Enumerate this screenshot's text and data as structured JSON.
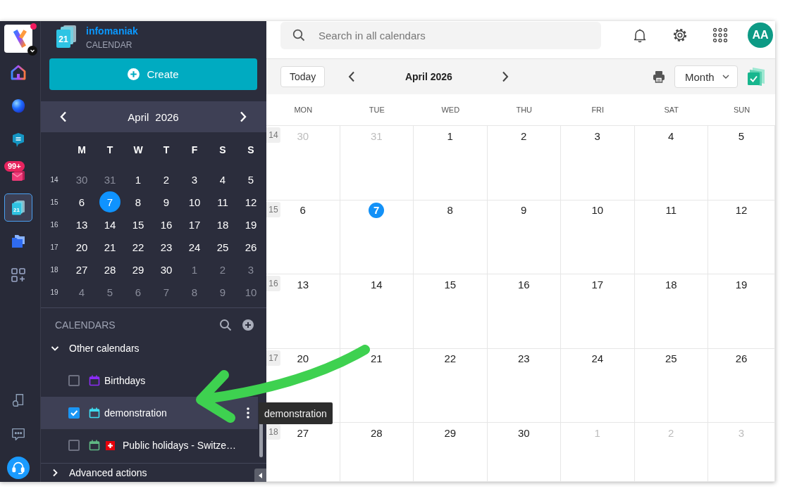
{
  "rail": {
    "logo": {
      "notification": true
    },
    "items": [
      {
        "selected": false
      },
      {
        "selected": false
      },
      {
        "selected": false
      },
      {
        "selected": false,
        "badge": "99+"
      },
      {
        "selected": true,
        "icon_text": "21"
      },
      {
        "selected": false
      },
      {
        "selected": false
      }
    ]
  },
  "sidebar": {
    "brand": {
      "name": "infomaniak",
      "product": "CALENDAR",
      "icon_text": "21"
    },
    "create_button": {
      "label": "Create"
    },
    "mini_calendar": {
      "month": "April",
      "year": "2026",
      "weekdays": [
        "M",
        "T",
        "W",
        "T",
        "F",
        "S",
        "S"
      ],
      "weeks": [
        {
          "number": "14",
          "days": [
            {
              "label": "30",
              "outside_month": true,
              "selected": false
            },
            {
              "label": "31",
              "outside_month": true,
              "selected": false
            },
            {
              "label": "1",
              "outside_month": false,
              "selected": false
            },
            {
              "label": "2",
              "outside_month": false,
              "selected": false
            },
            {
              "label": "3",
              "outside_month": false,
              "selected": false
            },
            {
              "label": "4",
              "outside_month": false,
              "selected": false
            },
            {
              "label": "5",
              "outside_month": false,
              "selected": false
            }
          ]
        },
        {
          "number": "15",
          "days": [
            {
              "label": "6",
              "outside_month": false,
              "selected": false
            },
            {
              "label": "7",
              "outside_month": false,
              "selected": true
            },
            {
              "label": "8",
              "outside_month": false,
              "selected": false
            },
            {
              "label": "9",
              "outside_month": false,
              "selected": false
            },
            {
              "label": "10",
              "outside_month": false,
              "selected": false
            },
            {
              "label": "11",
              "outside_month": false,
              "selected": false
            },
            {
              "label": "12",
              "outside_month": false,
              "selected": false
            }
          ]
        },
        {
          "number": "16",
          "days": [
            {
              "label": "13",
              "outside_month": false,
              "selected": false
            },
            {
              "label": "14",
              "outside_month": false,
              "selected": false
            },
            {
              "label": "15",
              "outside_month": false,
              "selected": false
            },
            {
              "label": "16",
              "outside_month": false,
              "selected": false
            },
            {
              "label": "17",
              "outside_month": false,
              "selected": false
            },
            {
              "label": "18",
              "outside_month": false,
              "selected": false
            },
            {
              "label": "19",
              "outside_month": false,
              "selected": false
            }
          ]
        },
        {
          "number": "17",
          "days": [
            {
              "label": "20",
              "outside_month": false,
              "selected": false
            },
            {
              "label": "21",
              "outside_month": false,
              "selected": false
            },
            {
              "label": "22",
              "outside_month": false,
              "selected": false
            },
            {
              "label": "23",
              "outside_month": false,
              "selected": false
            },
            {
              "label": "24",
              "outside_month": false,
              "selected": false
            },
            {
              "label": "25",
              "outside_month": false,
              "selected": false
            },
            {
              "label": "26",
              "outside_month": false,
              "selected": false
            }
          ]
        },
        {
          "number": "18",
          "days": [
            {
              "label": "27",
              "outside_month": false,
              "selected": false
            },
            {
              "label": "28",
              "outside_month": false,
              "selected": false
            },
            {
              "label": "29",
              "outside_month": false,
              "selected": false
            },
            {
              "label": "30",
              "outside_month": false,
              "selected": false
            },
            {
              "label": "1",
              "outside_month": true,
              "selected": false
            },
            {
              "label": "2",
              "outside_month": true,
              "selected": false
            },
            {
              "label": "3",
              "outside_month": true,
              "selected": false
            }
          ]
        },
        {
          "number": "19",
          "days": [
            {
              "label": "4",
              "outside_month": true,
              "selected": false
            },
            {
              "label": "5",
              "outside_month": true,
              "selected": false
            },
            {
              "label": "6",
              "outside_month": true,
              "selected": false
            },
            {
              "label": "7",
              "outside_month": true,
              "selected": false
            },
            {
              "label": "8",
              "outside_month": true,
              "selected": false
            },
            {
              "label": "9",
              "outside_month": true,
              "selected": false
            },
            {
              "label": "10",
              "outside_month": true,
              "selected": false
            }
          ]
        }
      ]
    },
    "calendars": {
      "title": "CALENDARS",
      "groups": [
        {
          "label": "Other calendars",
          "expanded": true,
          "items": [
            {
              "name": "Birthdays",
              "checked": false,
              "selected": false,
              "color": "#8b2cf5",
              "flag": false
            },
            {
              "name": "demonstration",
              "checked": true,
              "selected": true,
              "color": "#3fdcf0",
              "flag": false
            },
            {
              "name": "Public holidays - Switze…",
              "checked": false,
              "selected": false,
              "color": "#5fb884",
              "flag": true
            }
          ]
        }
      ]
    },
    "advanced_actions": {
      "label": "Advanced actions",
      "expanded": false
    }
  },
  "topbar": {
    "search": {
      "placeholder": "Search in all calendars"
    },
    "avatar": {
      "initials": "AA"
    }
  },
  "toolbar": {
    "today": "Today",
    "title": "April 2026",
    "view": {
      "value": "Month"
    }
  },
  "month_grid": {
    "columns": [
      "MON",
      "TUE",
      "WED",
      "THU",
      "FRI",
      "SAT",
      "SUN"
    ],
    "weeks": [
      {
        "number": "14",
        "days": [
          {
            "label": "30",
            "outside_month": true,
            "selected": false
          },
          {
            "label": "31",
            "outside_month": true,
            "selected": false
          },
          {
            "label": "1",
            "outside_month": false,
            "selected": false
          },
          {
            "label": "2",
            "outside_month": false,
            "selected": false
          },
          {
            "label": "3",
            "outside_month": false,
            "selected": false
          },
          {
            "label": "4",
            "outside_month": false,
            "selected": false
          },
          {
            "label": "5",
            "outside_month": false,
            "selected": false
          }
        ]
      },
      {
        "number": "15",
        "days": [
          {
            "label": "6",
            "outside_month": false,
            "selected": false
          },
          {
            "label": "7",
            "outside_month": false,
            "selected": true
          },
          {
            "label": "8",
            "outside_month": false,
            "selected": false
          },
          {
            "label": "9",
            "outside_month": false,
            "selected": false
          },
          {
            "label": "10",
            "outside_month": false,
            "selected": false
          },
          {
            "label": "11",
            "outside_month": false,
            "selected": false
          },
          {
            "label": "12",
            "outside_month": false,
            "selected": false
          }
        ]
      },
      {
        "number": "16",
        "days": [
          {
            "label": "13",
            "outside_month": false,
            "selected": false
          },
          {
            "label": "14",
            "outside_month": false,
            "selected": false
          },
          {
            "label": "15",
            "outside_month": false,
            "selected": false
          },
          {
            "label": "16",
            "outside_month": false,
            "selected": false
          },
          {
            "label": "17",
            "outside_month": false,
            "selected": false
          },
          {
            "label": "18",
            "outside_month": false,
            "selected": false
          },
          {
            "label": "19",
            "outside_month": false,
            "selected": false
          }
        ]
      },
      {
        "number": "17",
        "days": [
          {
            "label": "20",
            "outside_month": false,
            "selected": false
          },
          {
            "label": "21",
            "outside_month": false,
            "selected": false
          },
          {
            "label": "22",
            "outside_month": false,
            "selected": false
          },
          {
            "label": "23",
            "outside_month": false,
            "selected": false
          },
          {
            "label": "24",
            "outside_month": false,
            "selected": false
          },
          {
            "label": "25",
            "outside_month": false,
            "selected": false
          },
          {
            "label": "26",
            "outside_month": false,
            "selected": false
          }
        ]
      },
      {
        "number": "18",
        "days": [
          {
            "label": "27",
            "outside_month": false,
            "selected": false
          },
          {
            "label": "28",
            "outside_month": false,
            "selected": false
          },
          {
            "label": "29",
            "outside_month": false,
            "selected": false
          },
          {
            "label": "30",
            "outside_month": false,
            "selected": false
          },
          {
            "label": "1",
            "outside_month": true,
            "selected": false
          },
          {
            "label": "2",
            "outside_month": true,
            "selected": false
          },
          {
            "label": "3",
            "outside_month": true,
            "selected": false
          }
        ]
      }
    ]
  },
  "tooltip": {
    "text": "demonstration"
  }
}
